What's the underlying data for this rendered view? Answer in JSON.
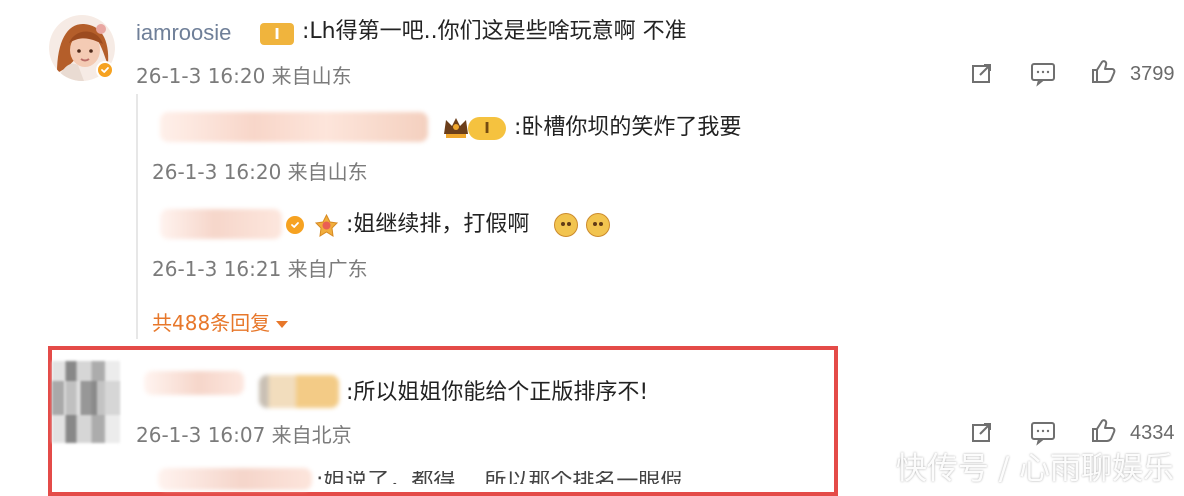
{
  "comments": [
    {
      "username": "iamroosie",
      "content": ":Lh得第一吧..你们这是些啥玩意啊 不准",
      "meta": "26-1-3 16:20 来自山东",
      "likes": "3799",
      "badge_label": "I"
    },
    {
      "content": ":所以姐姐你能给个正版排序不!",
      "meta": "26-1-3 16:07 来自北京",
      "likes": "4334"
    }
  ],
  "replies": [
    {
      "content": ":卧槽你坝的笑炸了我要",
      "meta": "26-1-3 16:20 来自山东",
      "badge_label": "I"
    },
    {
      "content": ":姐继续排，打假啊",
      "meta": "26-1-3 16:21 来自广东"
    }
  ],
  "reply_count": "共488条回复",
  "partial_reply_text": ":姐说了，都得… 所以那个排名一眼假",
  "watermark": "快传号 / 心雨聊娱乐",
  "icons": {
    "share": "share-icon",
    "comment": "comment-icon",
    "like": "like-icon"
  }
}
